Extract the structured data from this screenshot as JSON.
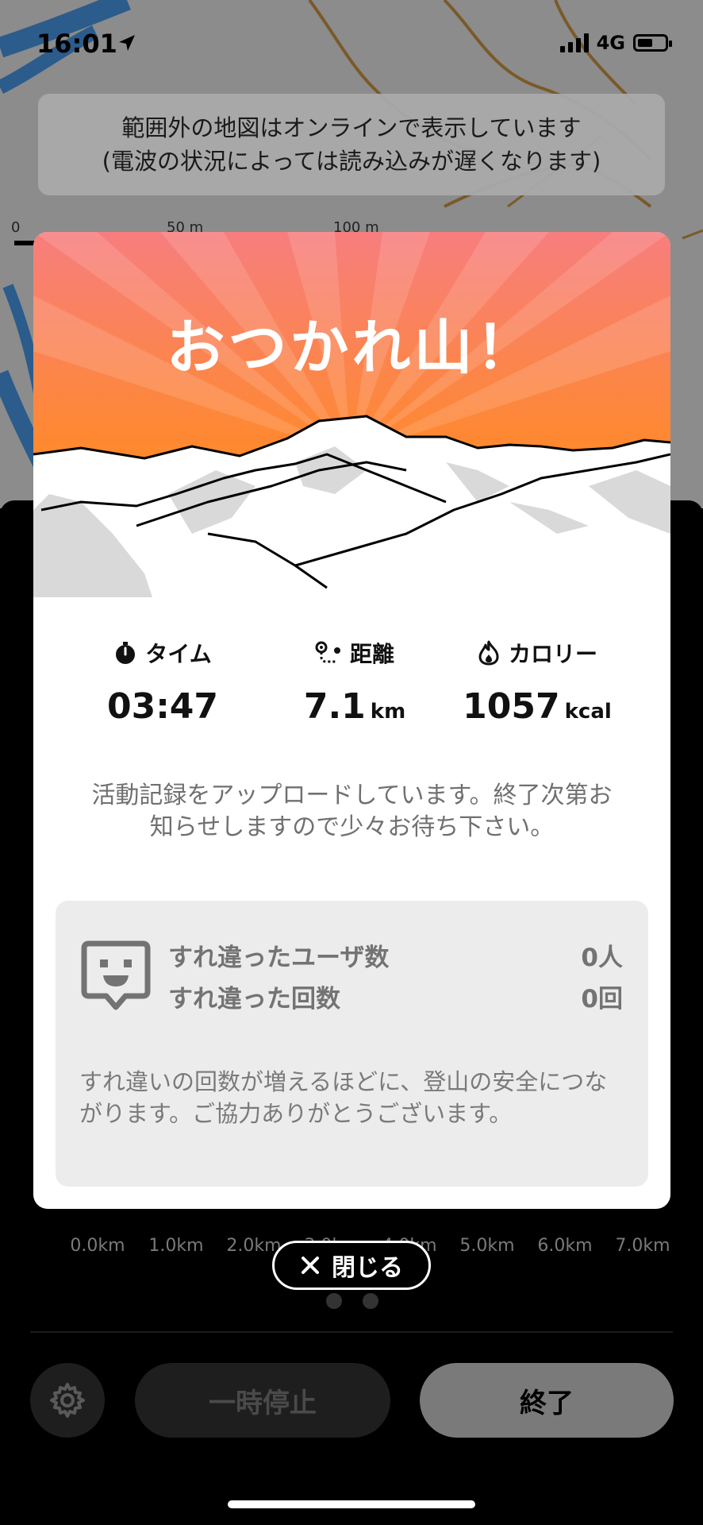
{
  "status_bar": {
    "time": "16:01",
    "network": "4G"
  },
  "map": {
    "offline_notice_line1": "範囲外の地図はオンラインで表示しています",
    "offline_notice_line2": "(電波の状況によっては読み込みが遅くなります)",
    "scale_labels": [
      "0",
      "50 m",
      "100 m"
    ]
  },
  "modal": {
    "title": "おつかれ山！",
    "stats": {
      "time": {
        "label": "タイム",
        "value": "03:47",
        "unit": "",
        "icon": "stopwatch-icon"
      },
      "distance": {
        "label": "距離",
        "value": "7.1",
        "unit": "km",
        "icon": "route-icon"
      },
      "calories": {
        "label": "カロリー",
        "value": "1057",
        "unit": "kcal",
        "icon": "flame-icon"
      }
    },
    "upload_message": "活動記録をアップロードしています。終了次第お知らせしますので少々お待ち下さい。",
    "encounter": {
      "users_label": "すれ違ったユーザ数",
      "users_value": "0人",
      "count_label": "すれ違った回数",
      "count_value": "0回",
      "note": "すれ違いの回数が増えるほどに、登山の安全につながります。ご協力ありがとうございます。"
    }
  },
  "chart_axis_labels": [
    "0.0km",
    "1.0km",
    "2.0km",
    "3.0km",
    "4.0km",
    "5.0km",
    "6.0km",
    "7.0km"
  ],
  "close_button_label": "閉じる",
  "controls": {
    "pause_label": "一時停止",
    "end_label": "終了"
  },
  "colors": {
    "header_top": "#f77a7a",
    "header_bottom": "#ff8a2a",
    "accent": "#ffffff"
  }
}
